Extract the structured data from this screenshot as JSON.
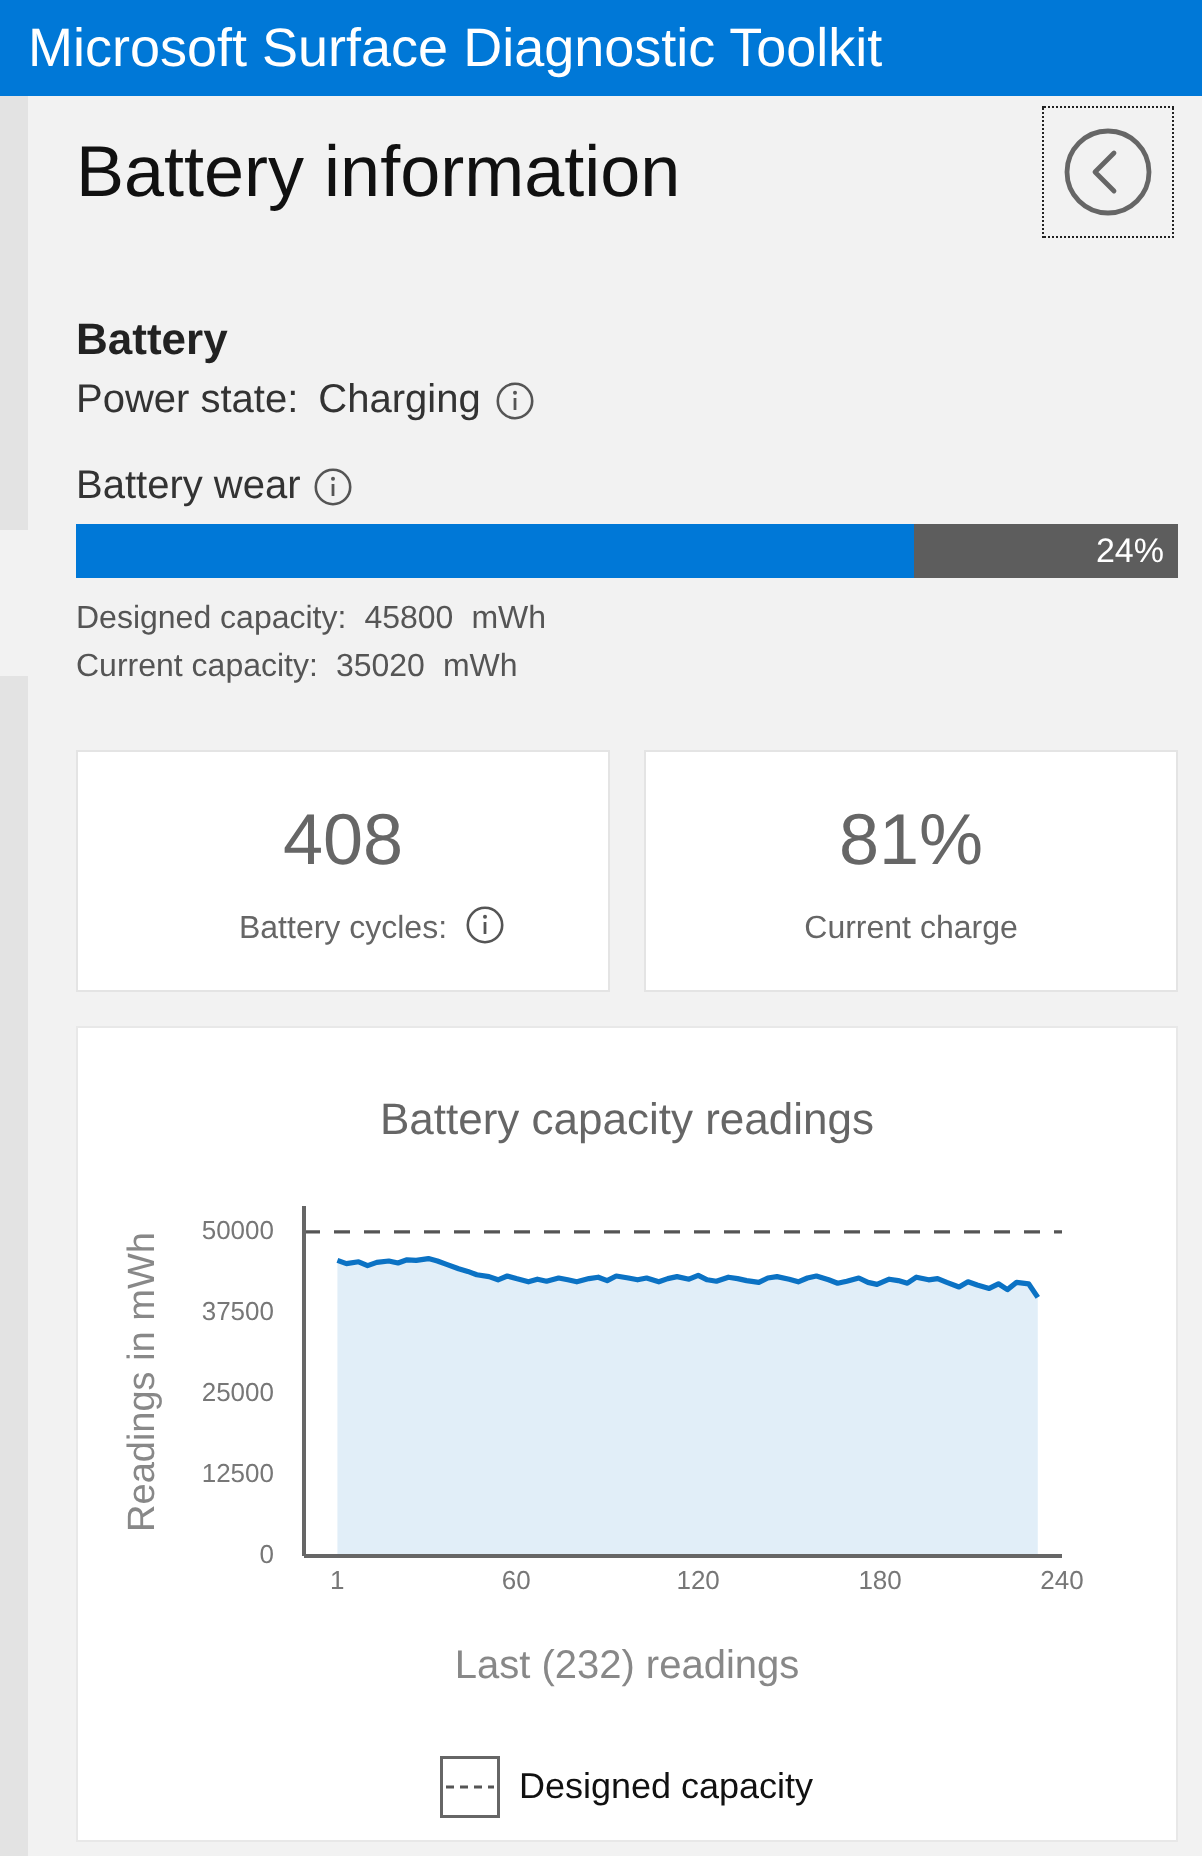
{
  "window": {
    "title": "Microsoft Surface Diagnostic Toolkit"
  },
  "page": {
    "title": "Battery information",
    "back_button": {
      "focused": true
    }
  },
  "battery": {
    "title": "Battery",
    "power_state": {
      "label": "Power state:",
      "value": "Charging"
    },
    "wear": {
      "label": "Battery wear",
      "level": 0.76,
      "reading": "24%"
    },
    "capacities": [
      {
        "label": "Designed capacity:",
        "value": "45800",
        "unit": "mWh"
      },
      {
        "label": "Current capacity:",
        "value": "35020",
        "unit": "mWh"
      }
    ]
  },
  "stats": [
    {
      "value": "408",
      "label": "Battery cycles:",
      "info": true
    },
    {
      "value": "81%",
      "label": "Current charge",
      "info": false
    }
  ],
  "chart": {
    "chart_data": {
      "type": "area",
      "title": "Battery capacity readings",
      "xlabel": "Last (232) readings",
      "ylabel": "Readings in mWh",
      "x": [
        1,
        4,
        8,
        11,
        14,
        18,
        21,
        24,
        27,
        31,
        34,
        37,
        41,
        44,
        47,
        51,
        54,
        57,
        60,
        64,
        67,
        70,
        74,
        77,
        80,
        84,
        87,
        90,
        93,
        97,
        100,
        103,
        107,
        110,
        113,
        117,
        120,
        123,
        126,
        130,
        133,
        136,
        140,
        143,
        146,
        150,
        153,
        156,
        159,
        163,
        166,
        169,
        173,
        176,
        179,
        183,
        186,
        189,
        192,
        196,
        199,
        202,
        206,
        209,
        212,
        216,
        219,
        222,
        225,
        229,
        232
      ],
      "series": [
        {
          "color": "#0b72c4",
          "values": [
            45600,
            45100,
            45400,
            44800,
            45300,
            45500,
            45200,
            45700,
            45600,
            45900,
            45500,
            45000,
            44300,
            43900,
            43400,
            43100,
            42600,
            43200,
            42800,
            42300,
            42700,
            42400,
            42900,
            42600,
            42300,
            42800,
            43000,
            42500,
            43200,
            42900,
            42600,
            42900,
            42300,
            42800,
            43100,
            42700,
            43300,
            42600,
            42400,
            43000,
            42800,
            42500,
            42200,
            42900,
            43100,
            42700,
            42300,
            42900,
            43200,
            42600,
            42100,
            42400,
            42900,
            42200,
            41900,
            42700,
            42500,
            42100,
            43000,
            42600,
            42800,
            42200,
            41500,
            42300,
            41800,
            41300,
            42000,
            41100,
            42200,
            42000,
            39900
          ]
        }
      ],
      "ref_lines": [
        {
          "axis": "y",
          "value": 50000,
          "label": "Designed capacity",
          "color": "#555555"
        }
      ],
      "xlim": [
        -10,
        240
      ],
      "ylim": [
        0,
        54000
      ],
      "xticks": [
        1,
        60,
        120,
        180,
        240
      ],
      "yticks": [
        0,
        12500,
        25000,
        37500,
        50000
      ]
    }
  }
}
